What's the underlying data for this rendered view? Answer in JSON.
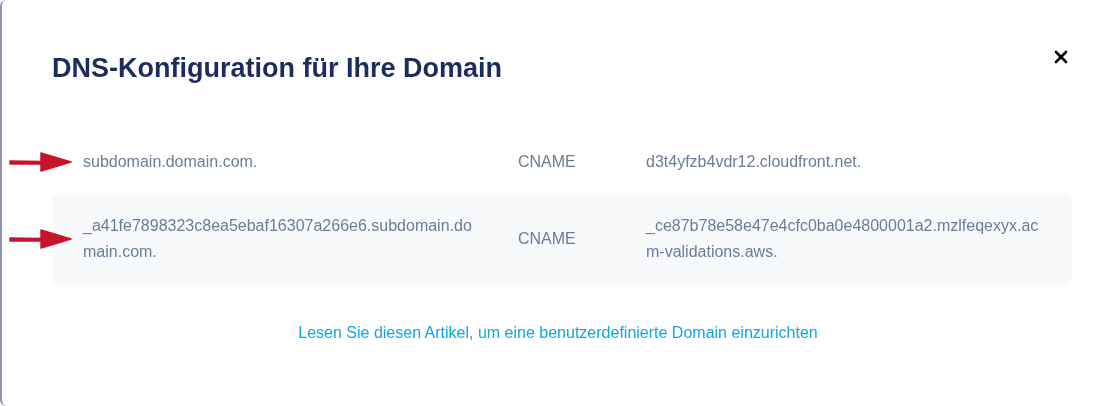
{
  "dialog": {
    "title": "DNS-Konfiguration für Ihre Domain"
  },
  "records": [
    {
      "name": "subdomain.domain.com.",
      "type": "CNAME",
      "value": "d3t4yfzb4vdr12.cloudfront.net."
    },
    {
      "name": "_a41fe7898323c8ea5ebaf16307a266e6.subdomain.domain.com.",
      "type": "CNAME",
      "value": "_ce87b78e58e47e4cfc0ba0e4800001a2.mzlfeqexyx.acm-validations.aws."
    }
  ],
  "help_link": "Lesen Sie diesen Artikel, um eine benutzerdefinierte Domain einzurichten"
}
